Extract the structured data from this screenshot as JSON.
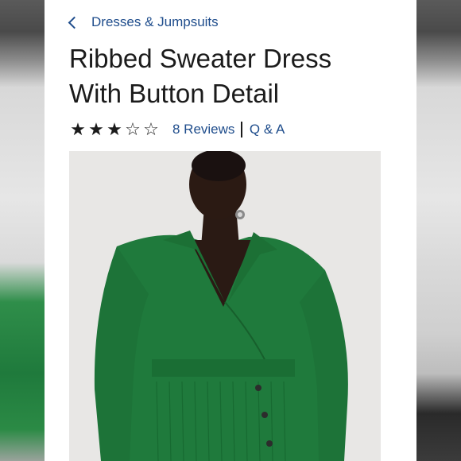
{
  "breadcrumb": {
    "label": "Dresses & Jumpsuits",
    "icon": "chevron-left-icon"
  },
  "product": {
    "title_line1": "Ribbed Sweater Dress",
    "title_line2": "With Button Detail"
  },
  "rating": {
    "value": 3,
    "max": 5,
    "reviews_label": "8 Reviews",
    "qa_label": "Q & A"
  },
  "image": {
    "subject": "model wearing green ribbed sweater dress"
  },
  "colors": {
    "link": "#1f4d8c",
    "dress": "#1f7a3c",
    "text": "#1b1b1b"
  }
}
